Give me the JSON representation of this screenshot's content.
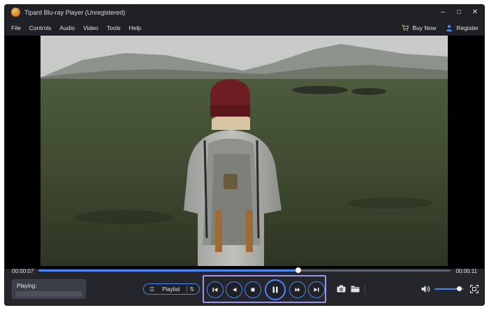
{
  "window": {
    "title": "Tipard Blu-ray Player (Unregistered)"
  },
  "window_controls": {
    "minimize": "–",
    "maximize": "□",
    "close": "✕"
  },
  "menu": {
    "items": [
      {
        "label": "File"
      },
      {
        "label": "Controls"
      },
      {
        "label": "Audio"
      },
      {
        "label": "Video"
      },
      {
        "label": "Tools"
      },
      {
        "label": "Help"
      }
    ],
    "buy_now": "Buy Now",
    "register": "Register"
  },
  "playback": {
    "current_time": "00:00:07",
    "total_time": "00:00:11",
    "progress_fraction": 0.63,
    "volume_fraction": 0.85,
    "playing_label": "Playing:"
  },
  "controls": {
    "playlist_label": "Playlist",
    "highlight_color": "#9f95e8",
    "accent_color": "#4c86f6"
  }
}
